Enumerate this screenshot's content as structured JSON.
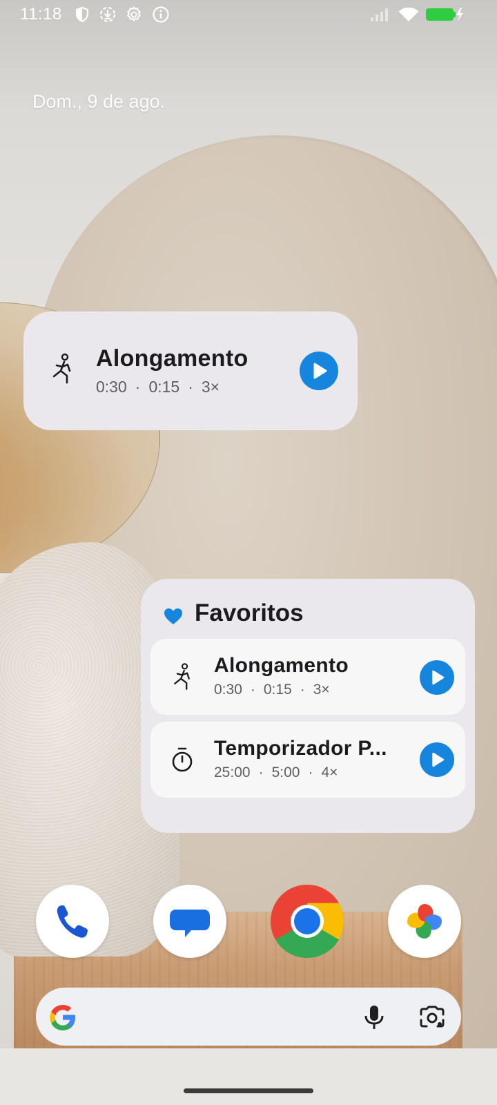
{
  "status_bar": {
    "time": "11:18",
    "left_icons": [
      "shield-icon",
      "download-icon",
      "settings-icon",
      "info-icon"
    ],
    "right_icons": [
      "signal-icon",
      "wifi-icon",
      "battery-charging-icon"
    ],
    "battery_color": "#2ecc40"
  },
  "date": "Dom., 9 de ago.",
  "widget_single": {
    "title": "Alongamento",
    "work": "0:30",
    "rest": "0:15",
    "rounds": "3×",
    "icon": "stretching-person-icon"
  },
  "favorites": {
    "title": "Favoritos",
    "items": [
      {
        "title": "Alongamento",
        "work": "0:30",
        "rest": "0:15",
        "rounds": "3×",
        "icon": "stretching-person-icon"
      },
      {
        "title": "Temporizador P...",
        "work": "25:00",
        "rest": "5:00",
        "rounds": "4×",
        "icon": "stopwatch-icon"
      }
    ]
  },
  "dock": {
    "apps": [
      "phone-app-icon",
      "messages-app-icon",
      "chrome-app-icon",
      "photos-app-icon"
    ]
  },
  "search": {
    "icons": [
      "google-logo-icon",
      "microphone-icon",
      "lens-camera-icon"
    ]
  },
  "colors": {
    "accent": "#1685dd",
    "widget_bg": "#eae8ec"
  }
}
